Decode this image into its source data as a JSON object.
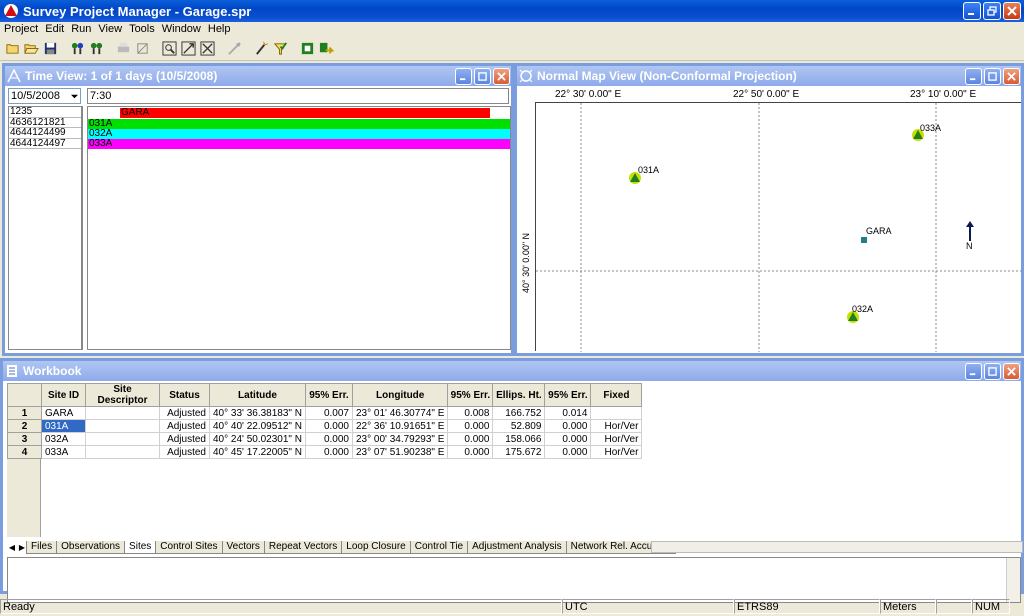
{
  "app": {
    "title": "Survey Project Manager - Garage.spr"
  },
  "menu": [
    "Project",
    "Edit",
    "Run",
    "View",
    "Tools",
    "Window",
    "Help"
  ],
  "toolbar": {
    "icons": [
      "new-icon",
      "open-icon",
      "save-icon",
      "sites-icon",
      "sites-edit-icon",
      "disabled-icon",
      "zoom-box-icon",
      "zoom-in-icon",
      "zoom-out-icon",
      "zoom-fit-icon",
      "disabled-icon",
      "wand-icon",
      "grid-icon",
      "check-icon",
      "adjust-icon",
      "export-icon"
    ]
  },
  "timeview": {
    "title": "Time View: 1 of 1 days (10/5/2008)",
    "date": "10/5/2008",
    "time": "7:30",
    "rows": [
      {
        "id": "1235",
        "label": "GARA",
        "color": "#ff0000"
      },
      {
        "id": "4636121821",
        "label": "031A",
        "color": "#00e000"
      },
      {
        "id": "4644124499",
        "label": "032A",
        "color": "#00ffff"
      },
      {
        "id": "4644124497",
        "label": "033A",
        "color": "#ff00ff"
      }
    ]
  },
  "mapview": {
    "title": "Normal Map View (Non-Conformal Projection)",
    "lon_ticks": [
      "22° 30' 0.00\" E",
      "22° 50' 0.00\" E",
      "23° 10' 0.00\" E"
    ],
    "lat_tick": "40° 30' 0.00\" N",
    "north_label": "N",
    "points": [
      {
        "name": "031A",
        "type": "triangle"
      },
      {
        "name": "033A",
        "type": "triangle"
      },
      {
        "name": "GARA",
        "type": "square"
      },
      {
        "name": "032A",
        "type": "triangle"
      }
    ]
  },
  "workbook": {
    "title": "Workbook",
    "columns": [
      "Site ID",
      "Site Descriptor",
      "Status",
      "Latitude",
      "95% Err.",
      "Longitude",
      "95% Err.",
      "Ellips. Ht.",
      "95% Err.",
      "Fixed"
    ],
    "rows": [
      {
        "n": "1",
        "site": "GARA",
        "desc": "",
        "status": "Adjusted",
        "lat": "40° 33' 36.38183\" N",
        "lat_err": "0.007",
        "lon": "23° 01' 46.30774\" E",
        "lon_err": "0.008",
        "ht": "166.752",
        "ht_err": "0.014",
        "fixed": ""
      },
      {
        "n": "2",
        "site": "031A",
        "desc": "",
        "status": "Adjusted",
        "lat": "40° 40' 22.09512\" N",
        "lat_err": "0.000",
        "lon": "22° 36' 10.91651\" E",
        "lon_err": "0.000",
        "ht": "52.809",
        "ht_err": "0.000",
        "fixed": "Hor/Ver"
      },
      {
        "n": "3",
        "site": "032A",
        "desc": "",
        "status": "Adjusted",
        "lat": "40° 24' 50.02301\" N",
        "lat_err": "0.000",
        "lon": "23° 00' 34.79293\" E",
        "lon_err": "0.000",
        "ht": "158.066",
        "ht_err": "0.000",
        "fixed": "Hor/Ver"
      },
      {
        "n": "4",
        "site": "033A",
        "desc": "",
        "status": "Adjusted",
        "lat": "40° 45' 17.22005\" N",
        "lat_err": "0.000",
        "lon": "23° 07' 51.90238\" E",
        "lon_err": "0.000",
        "ht": "175.672",
        "ht_err": "0.000",
        "fixed": "Hor/Ver"
      }
    ],
    "tabs": [
      "Files",
      "Observations",
      "Sites",
      "Control Sites",
      "Vectors",
      "Repeat Vectors",
      "Loop Closure",
      "Control Tie",
      "Adjustment Analysis",
      "Network Rel. Accuracy"
    ],
    "active_tab": "Sites"
  },
  "status": {
    "ready": "Ready",
    "tz": "UTC",
    "datum": "ETRS89",
    "units": "Meters",
    "num": "NUM"
  }
}
